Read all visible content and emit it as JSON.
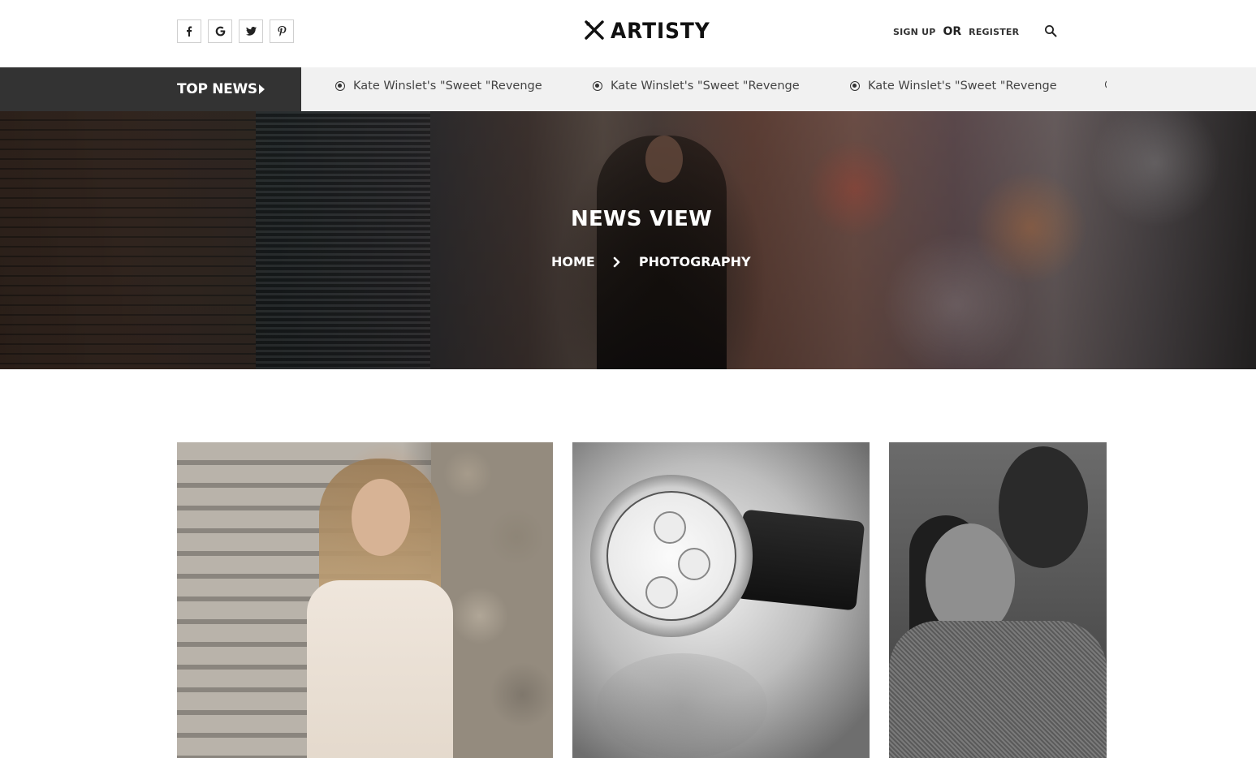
{
  "header": {
    "social": [
      {
        "name": "facebook",
        "icon": "facebook-icon"
      },
      {
        "name": "google",
        "icon": "google-icon"
      },
      {
        "name": "twitter",
        "icon": "twitter-icon"
      },
      {
        "name": "pinterest",
        "icon": "pinterest-icon"
      }
    ],
    "logo_text": "ARTISTY",
    "logo_icon": "crossed-tools-icon",
    "sign_up": "SIGN UP",
    "or": "OR",
    "register": "REGISTER",
    "search_icon": "search-icon"
  },
  "ticker": {
    "label": "TOP NEWS",
    "items": [
      "Kate Winslet's \"Sweet \"Revenge",
      "Kate Winslet's \"Sweet \"Revenge",
      "Kate Winslet's \"Sweet \"Revenge"
    ]
  },
  "hero": {
    "title": "NEWS VIEW",
    "breadcrumb": [
      "HOME",
      "PHOTOGRAPHY"
    ]
  },
  "gallery": [
    {
      "image": "woman-on-stairs-photo"
    },
    {
      "image": "wristwatch-photo"
    },
    {
      "image": "two-women-portrait-photo"
    }
  ],
  "colors": {
    "ticker_label_bg": "#333333",
    "ticker_bg": "#f1f1f1",
    "text_dark": "#222222"
  }
}
